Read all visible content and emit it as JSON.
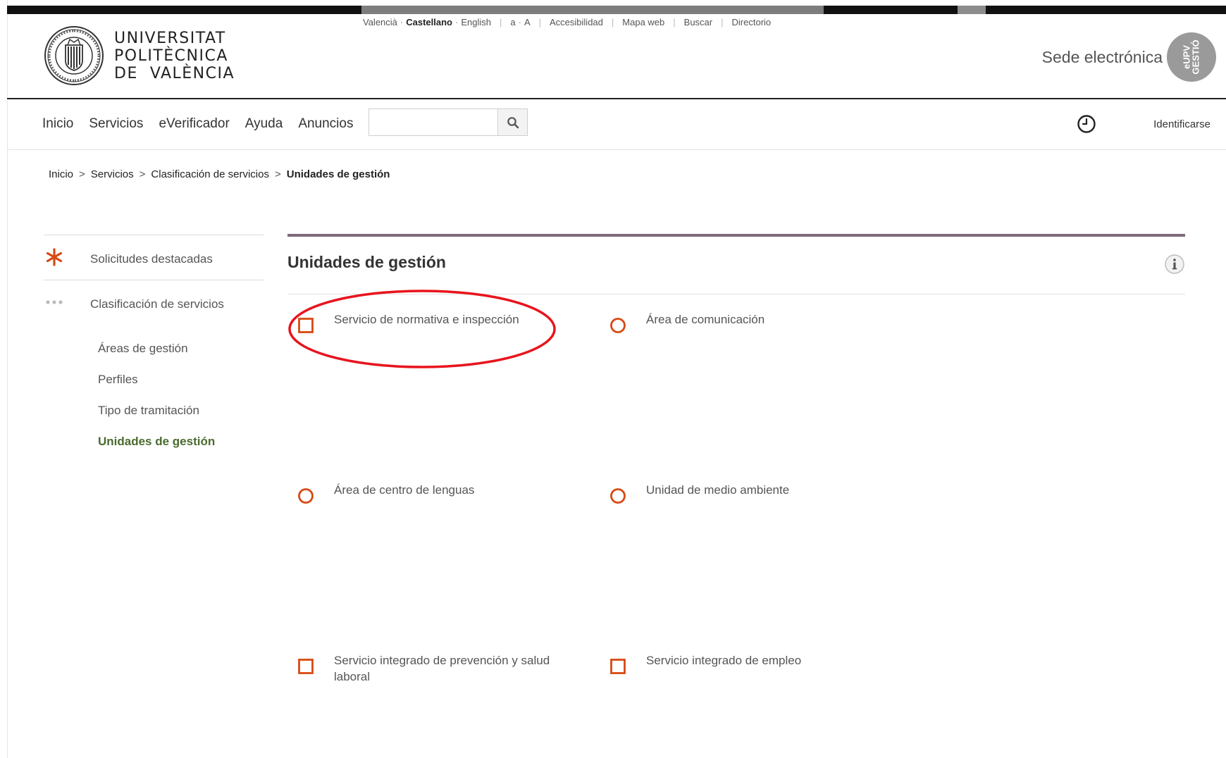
{
  "header": {
    "logo_lines": [
      "UNIVERSITAT",
      "POLITÈCNICA",
      "DE  VALÈNCIA"
    ],
    "utility": {
      "languages": [
        "Valencià",
        "Castellano",
        "English"
      ],
      "active_language": "Castellano",
      "font_size": [
        "a",
        "A"
      ],
      "links": [
        "Accesibilidad",
        "Mapa web",
        "Buscar",
        "Directorio"
      ]
    },
    "sede_label": "Sede electrónica",
    "badge_top": "UPV",
    "badge_prefix": "e",
    "badge_bottom": "GESTIÓ"
  },
  "nav": {
    "items": [
      "Inicio",
      "Servicios",
      "eVerificador",
      "Ayuda",
      "Anuncios"
    ],
    "search_placeholder": "",
    "search_icon": "search-icon",
    "history_icon": "clock-icon",
    "login_label": "Identificarse"
  },
  "breadcrumb": {
    "items": [
      "Inicio",
      "Servicios",
      "Clasificación de servicios"
    ],
    "separator": ">",
    "current": "Unidades de gestión"
  },
  "sidebar": {
    "blocks": [
      {
        "label": "Solicitudes destacadas",
        "icon": "asterisk-icon"
      },
      {
        "label": "Clasificación de servicios",
        "icon": "dots-icon"
      }
    ],
    "sub_items": [
      "Áreas de gestión",
      "Perfiles",
      "Tipo de tramitación",
      "Unidades de gestión"
    ],
    "active_sub_item": "Unidades de gestión"
  },
  "main": {
    "title": "Unidades de gestión",
    "info_icon": "info-icon",
    "items": [
      {
        "label": "Servicio de normativa e inspección",
        "icon": "square-icon"
      },
      {
        "label": "Área de comunicación",
        "icon": "circle-icon"
      },
      {
        "label": "Área de centro de lenguas",
        "icon": "circle-icon"
      },
      {
        "label": "Unidad de medio ambiente",
        "icon": "circle-icon"
      },
      {
        "label": "Servicio integrado de prevención y salud laboral",
        "icon": "square-icon"
      },
      {
        "label": "Servicio integrado de empleo",
        "icon": "square-icon"
      }
    ]
  },
  "colors": {
    "accent_orange": "#d64a13",
    "active_green": "#4a6b2f",
    "rule_mauve": "#7d6a7a",
    "highlight_red": "#e8141e"
  }
}
